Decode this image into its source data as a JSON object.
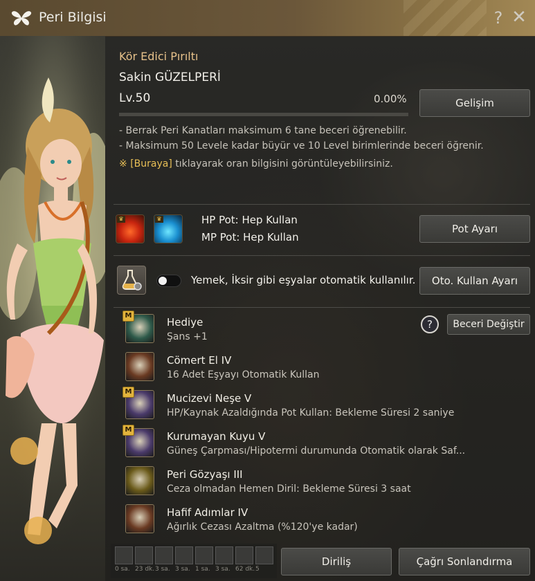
{
  "window": {
    "title": "Peri Bilgisi",
    "help_glyph": "?",
    "close_glyph": "✕"
  },
  "peri": {
    "rank": "Kör Edici Pırıltı",
    "name": "Sakin GÜZELPERİ",
    "level_prefix": "Lv.",
    "level": "50",
    "progress_text": "0.00%",
    "progress_fraction": 0.0,
    "upgrade_button": "Gelişim"
  },
  "notes": {
    "line1": "- Berrak Peri Kanatları maksimum 6 tane beceri öğrenebilir.",
    "line2": "- Maksimum 50 Levele kadar büyür ve 10 Level birimlerinde beceri öğrenir.",
    "line3_prefix": "※ ",
    "line3_link": "[Buraya]",
    "line3_suffix": " tıklayarak oran bilgisini görüntüleyebilirsiniz."
  },
  "potions": {
    "hp": "HP Pot: Hep Kullan",
    "mp": "MP Pot: Hep Kullan",
    "settings_button": "Pot Ayarı",
    "hp_icon": "hp-potion-icon",
    "mp_icon": "mp-potion-icon"
  },
  "auto_use": {
    "text": "Yemek, İksir gibi eşyalar otomatik kullanılır.",
    "toggle_on": false,
    "settings_button": "Oto. Kullan Ayarı"
  },
  "skills_header": {
    "help_glyph": "?",
    "change_button": "Beceri Değiştir"
  },
  "skills": [
    {
      "name": "Hediye",
      "desc": "Şans +1",
      "mastery": "M",
      "icon": "clover-icon",
      "color": "#2e5a4a"
    },
    {
      "name": "Cömert El IV",
      "desc": "16 Adet Eşyayı Otomatik Kullan",
      "mastery": "",
      "icon": "fairy-icon",
      "color": "#6a3a22"
    },
    {
      "name": "Mucizevi Neşe V",
      "desc": "HP/Kaynak Azaldığında Pot Kullan: Bekleme Süresi 2 saniye",
      "mastery": "M",
      "icon": "potion-bottle-icon",
      "color": "#4a3a6a"
    },
    {
      "name": "Kurumayan Kuyu V",
      "desc": "Güneş Çarpması/Hipotermi durumunda Otomatik olarak Saf...",
      "mastery": "M",
      "icon": "bowl-icon",
      "color": "#4a3a6a"
    },
    {
      "name": "Peri Gözyaşı III",
      "desc": "Ceza olmadan Hemen Diril: Bekleme Süresi 3 saat",
      "mastery": "",
      "icon": "winged-tear-icon",
      "color": "#6a5a1a"
    },
    {
      "name": "Hafif Adımlar IV",
      "desc": "Ağırlık Cezası Azaltma (%120'ye kadar)",
      "mastery": "",
      "icon": "weight-icon",
      "color": "#6a3a22"
    }
  ],
  "footer": {
    "revive_button": "Diriliş",
    "end_call_button": "Çağrı Sonlandırma"
  },
  "buffs": [
    {
      "label": "0 sa."
    },
    {
      "label": "23 dk."
    },
    {
      "label": "3 sa."
    },
    {
      "label": "3 sa."
    },
    {
      "label": "1 sa."
    },
    {
      "label": "3 sa."
    },
    {
      "label": "62 dk."
    },
    {
      "label": "5"
    }
  ]
}
